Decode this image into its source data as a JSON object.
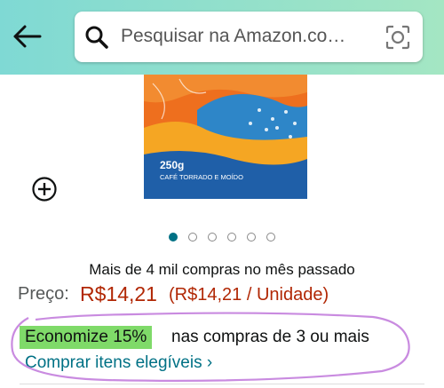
{
  "header": {
    "search_placeholder": "Pesquisar na Amazon.co…",
    "colors": {
      "bar_start": "#7fd9d4",
      "bar_end": "#a4e6c3"
    }
  },
  "icons": {
    "back": "arrow-left-icon",
    "search": "search-icon",
    "camera": "camera-search-icon",
    "zoom": "zoom-plus-icon"
  },
  "product": {
    "package_weight": "250g",
    "package_desc": "CAFÉ TORRADO E MOÍDO"
  },
  "carousel": {
    "total": 6,
    "active_index": 0
  },
  "info": {
    "bought_text": "Mais de 4 mil compras no mês passado",
    "price_label": "Preço:",
    "price": "R$14,21",
    "unit_price": "(R$14,21 / Unidade)"
  },
  "promo": {
    "badge": "Economize 15%",
    "text": "nas compras de 3 ou mais",
    "link": "Comprar itens elegíveis ›"
  }
}
